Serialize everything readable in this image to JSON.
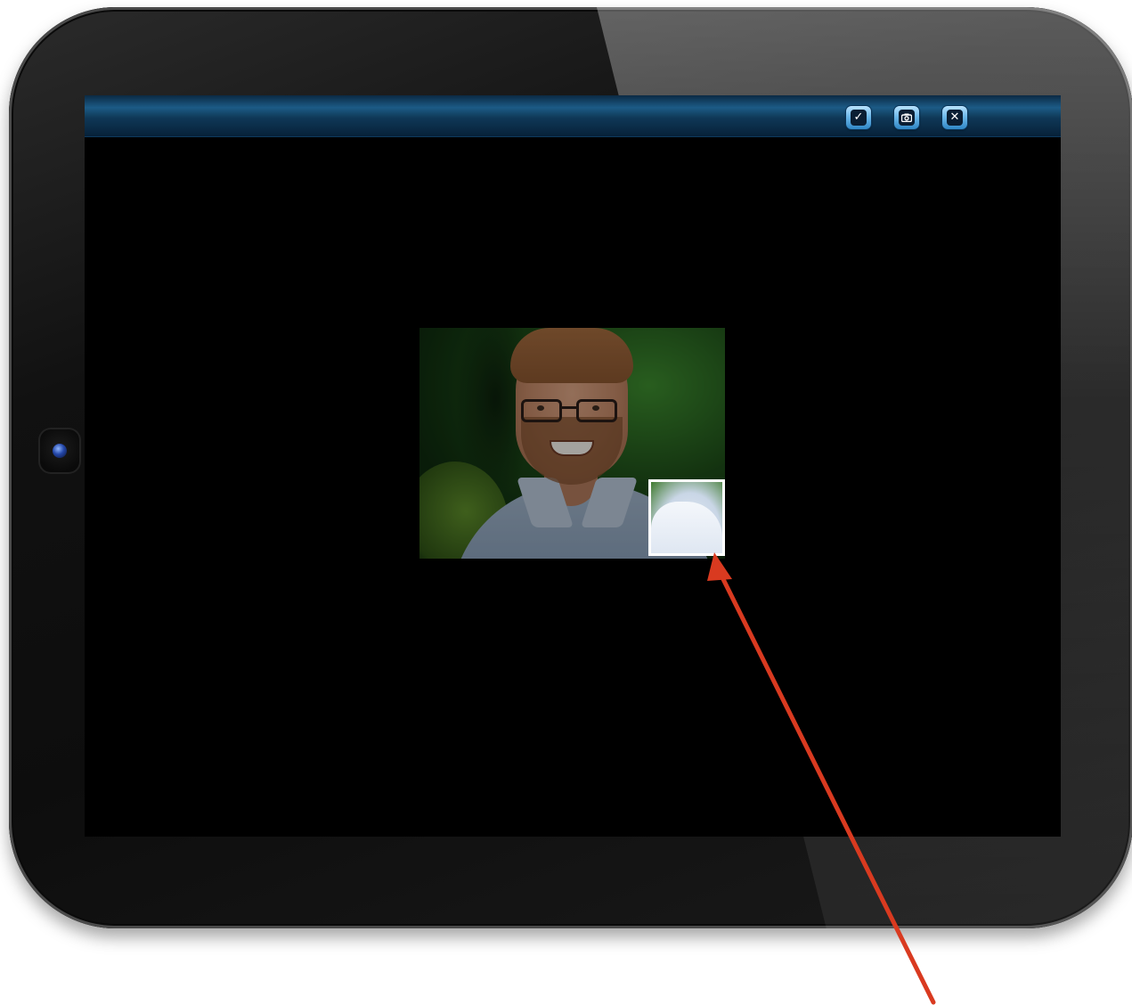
{
  "window": {
    "title": ""
  },
  "toolbar": {
    "buttons": [
      {
        "name": "confirm",
        "icon": "checkmark-icon",
        "glyph": "✓"
      },
      {
        "name": "camera",
        "icon": "camera-icon",
        "glyph": ""
      },
      {
        "name": "close",
        "icon": "close-icon",
        "glyph": "✕"
      }
    ]
  },
  "photo": {
    "description": "",
    "selection_active": true
  },
  "annotation": {
    "color": "#d93a20"
  },
  "colors": {
    "toolbar_top": "#0b2a44",
    "toolbar_mid": "#1c5b86",
    "button_accent": "#6fb9ea",
    "screen_background": "#000000",
    "selection_border": "#ffffff"
  }
}
